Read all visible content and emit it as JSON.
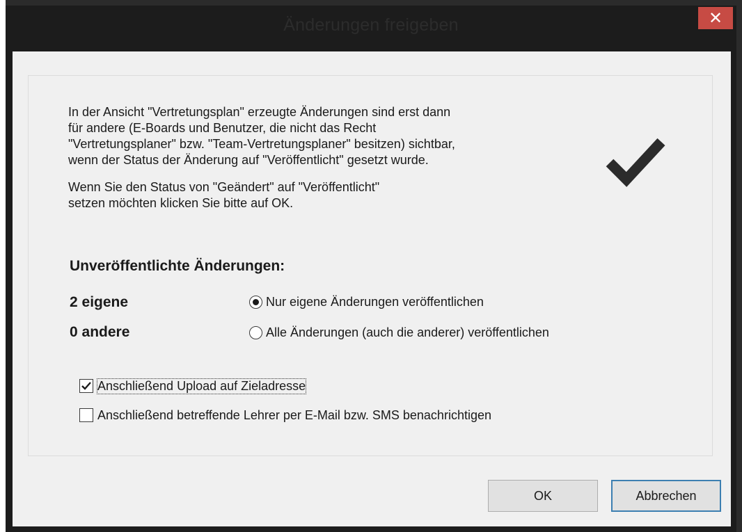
{
  "window": {
    "title": "Änderungen freigeben",
    "close_glyph": "✕"
  },
  "description": {
    "lines": [
      "In der Ansicht \"Vertretungsplan\" erzeugte Änderungen sind erst dann",
      "für andere (E-Boards und Benutzer, die nicht das Recht",
      "\"Vertretungsplaner\" bzw. \"Team-Vertretungsplaner\" besitzen) sichtbar,",
      "wenn der Status der Änderung auf \"Veröffentlicht\" gesetzt wurde."
    ],
    "instruction_lines": [
      "Wenn Sie den Status von \"Geändert\" auf \"Veröffentlicht\"",
      "setzen möchten klicken Sie bitte auf OK."
    ],
    "icon": "checkmark-icon"
  },
  "unpublished": {
    "heading": "Unveröffentlichte Änderungen:",
    "own_count_label": "2 eigene",
    "other_count_label": "0 andere"
  },
  "publish_options": [
    {
      "label": "Nur eigene Änderungen veröffentlichen",
      "selected": true
    },
    {
      "label": "Alle Änderungen (auch die anderer) veröffentlichen",
      "selected": false
    }
  ],
  "after_actions": [
    {
      "label": "Anschließend Upload auf Zieladresse",
      "checked": true
    },
    {
      "label": "Anschließend betreffende Lehrer per E-Mail bzw. SMS benachrichtigen",
      "checked": false
    }
  ],
  "buttons": {
    "ok_label": "OK",
    "cancel_label": "Abbrechen"
  },
  "colors": {
    "close_button": "#c74b44",
    "default_button_border": "#3c7fb1",
    "client_background": "#f0f0f0",
    "titlebar": "#1c1c1c"
  }
}
